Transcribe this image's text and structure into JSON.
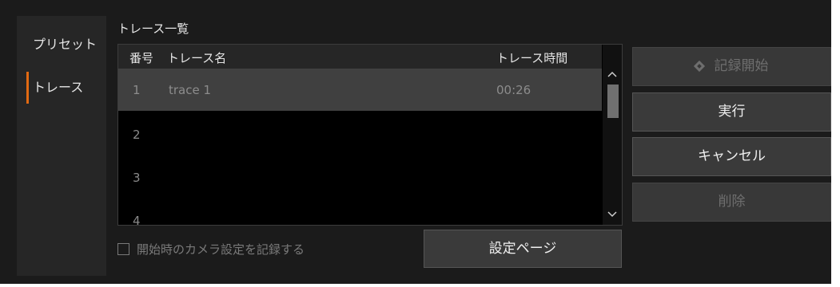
{
  "sidebar": {
    "items": [
      {
        "label": "プリセット",
        "active": false
      },
      {
        "label": "トレース",
        "active": true
      }
    ]
  },
  "trace_list": {
    "title": "トレース一覧",
    "columns": {
      "number": "番号",
      "name": "トレース名",
      "time": "トレース時間"
    },
    "rows": [
      {
        "number": "1",
        "name": "trace 1",
        "time": "00:26",
        "selected": true
      },
      {
        "number": "2",
        "name": "",
        "time": ""
      },
      {
        "number": "3",
        "name": "",
        "time": ""
      },
      {
        "number": "4",
        "name": "",
        "time": ""
      }
    ],
    "scroll_up_icon": "chevron-up",
    "scroll_down_icon": "chevron-down"
  },
  "options": {
    "record_camera_settings_label": "開始時のカメラ設定を記録する",
    "record_camera_settings_checked": false
  },
  "buttons": {
    "settings_page": "設定ページ",
    "start_recording": "記録開始",
    "execute": "実行",
    "cancel": "キャンセル",
    "delete": "削除"
  },
  "colors": {
    "accent": "#e26a12",
    "panel_bg": "#1b1b1b",
    "list_bg": "#000000",
    "selected_row": "#404040"
  }
}
